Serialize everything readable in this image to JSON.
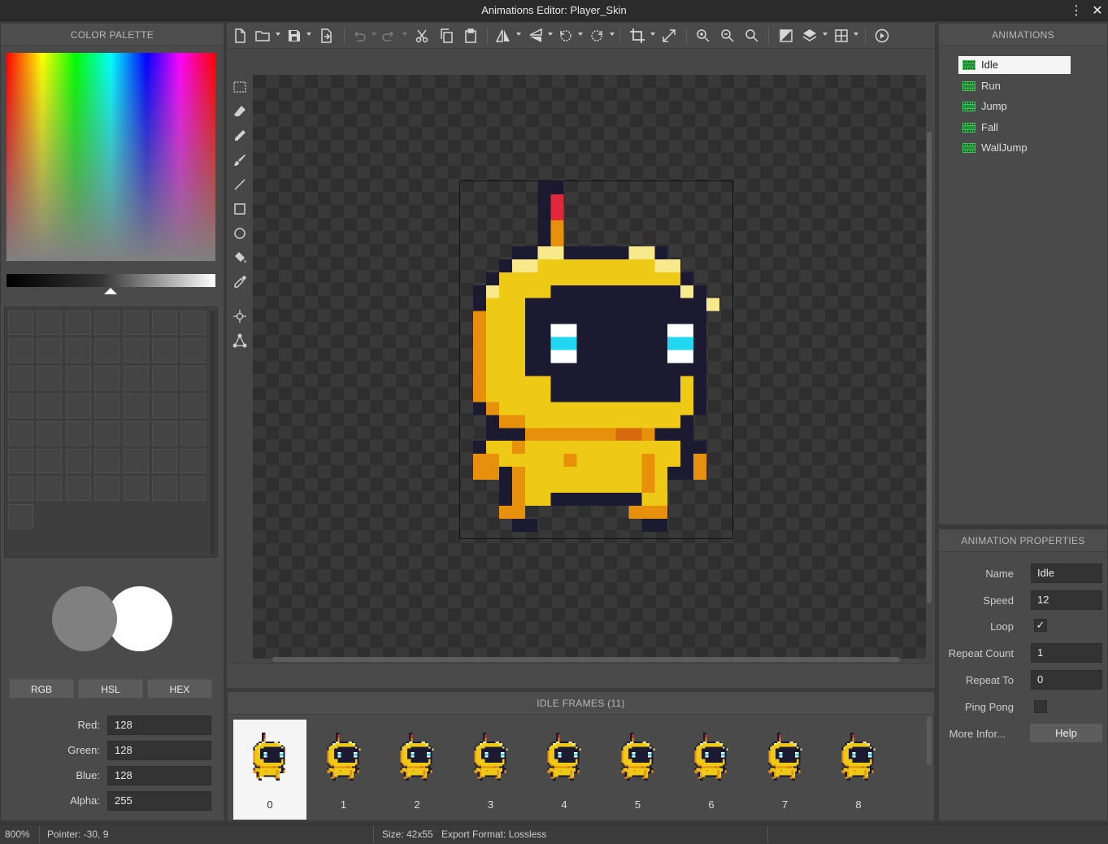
{
  "window": {
    "title": "Animations Editor: Player_Skin"
  },
  "palette": {
    "header": "COLOR PALETTE",
    "primary_color": "#808080",
    "secondary_color": "#ffffff",
    "modes": [
      "RGB",
      "HSL",
      "HEX"
    ],
    "fields": [
      {
        "label": "Red:",
        "value": "128"
      },
      {
        "label": "Green:",
        "value": "128"
      },
      {
        "label": "Blue:",
        "value": "128"
      },
      {
        "label": "Alpha:",
        "value": "255"
      }
    ]
  },
  "toolbar": {
    "icons": [
      "new-file-icon",
      "open-folder-icon",
      "save-icon",
      "export-icon",
      "undo-icon",
      "redo-icon",
      "cut-icon",
      "copy-icon",
      "paste-icon",
      "flip-horizontal-icon",
      "flip-vertical-icon",
      "rotate-left-icon",
      "rotate-right-icon",
      "crop-icon",
      "resize-icon",
      "zoom-in-icon",
      "zoom-out-icon",
      "zoom-reset-icon",
      "background-icon",
      "layers-icon",
      "grid-icon",
      "play-icon"
    ]
  },
  "tools": [
    "selection-tool-icon",
    "eraser-tool-icon",
    "pencil-tool-icon",
    "brush-tool-icon",
    "line-tool-icon",
    "rectangle-tool-icon",
    "ellipse-tool-icon",
    "fill-tool-icon",
    "eyedropper-tool-icon",
    "pivot-tool-icon",
    "skeleton-tool-icon"
  ],
  "frames": {
    "header": "IDLE FRAMES (11)",
    "items": [
      "0",
      "1",
      "2",
      "3",
      "4",
      "5",
      "6",
      "7",
      "8"
    ],
    "selected": 0
  },
  "animations": {
    "header": "ANIMATIONS",
    "items": [
      "Idle",
      "Run",
      "Jump",
      "Fall",
      "WallJump"
    ],
    "selected": 0,
    "icon_color": "#33cc55"
  },
  "properties": {
    "header": "ANIMATION PROPERTIES",
    "name_label": "Name",
    "name_value": "Idle",
    "speed_label": "Speed",
    "speed_value": "12",
    "loop_label": "Loop",
    "loop_checked": "✓",
    "repeat_count_label": "Repeat Count",
    "repeat_count_value": "1",
    "repeat_to_label": "Repeat To",
    "repeat_to_value": "0",
    "ping_pong_label": "Ping Pong",
    "more_info_label": "More Infor...",
    "help_label": "Help"
  },
  "status": {
    "zoom": "800%",
    "pointer": "Pointer: -30, 9",
    "size": "Size: 42x55",
    "export_format": "Export Format: Lossless"
  },
  "sprite_colors": {
    "outline": "#1c1a30",
    "body": "#eec916",
    "shade": "#e6900c",
    "highlight": "#f8e98a",
    "eye": "#22d8f0",
    "antenna": "#e0283a"
  }
}
